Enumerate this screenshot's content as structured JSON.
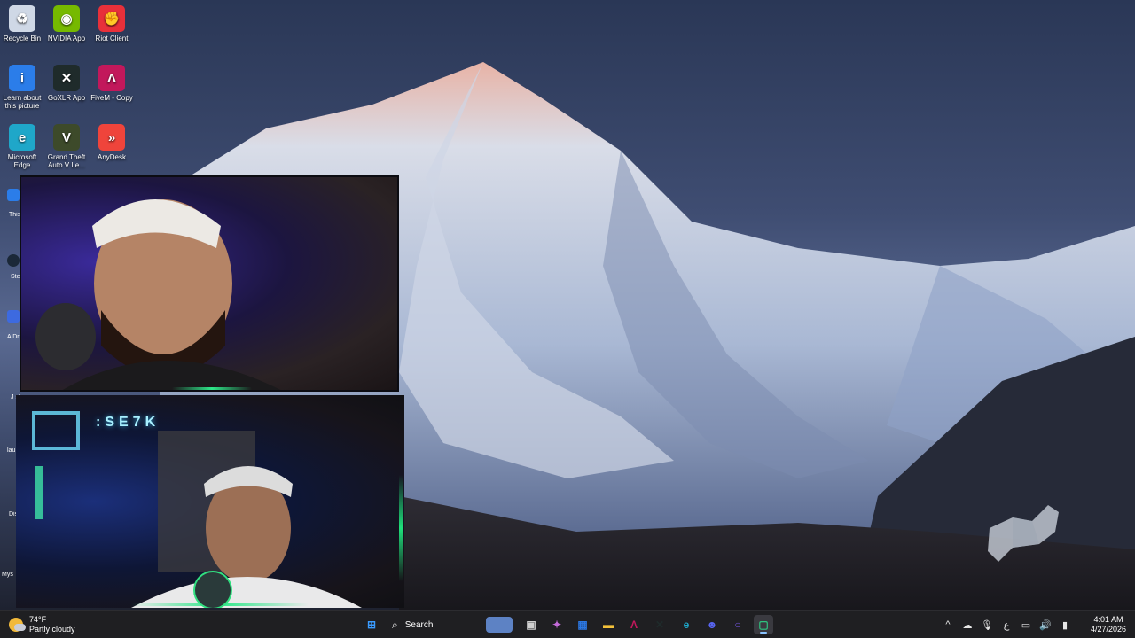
{
  "desktop": {
    "icons": [
      {
        "label": "Recycle Bin",
        "icon": "recycle-bin-icon",
        "color": "#cfd8e6"
      },
      {
        "label": "NVIDIA App",
        "icon": "nvidia-icon",
        "color": "#76b900"
      },
      {
        "label": "Riot Client",
        "icon": "riot-client-icon",
        "color": "#e8303a"
      },
      {
        "label": "Learn about this picture",
        "icon": "learn-picture-icon",
        "color": "#2b7de9"
      },
      {
        "label": "GoXLR App",
        "icon": "goxlr-icon",
        "color": "#1f2b2b"
      },
      {
        "label": "FiveM - Copy",
        "icon": "fivem-icon",
        "color": "#c2185b"
      },
      {
        "label": "Microsoft Edge",
        "icon": "edge-icon",
        "color": "#1fa7c9"
      },
      {
        "label": "Grand Theft Auto V Le...",
        "icon": "gta-v-icon",
        "color": "#3d4a2a"
      },
      {
        "label": "AnyDesk",
        "icon": "anydesk-icon",
        "color": "#ef443b"
      }
    ],
    "partial_icon_labels": [
      "This Sho",
      "Ste",
      "A Drive",
      "J sh",
      "lau Sh",
      "Dis",
      "Mys"
    ]
  },
  "overlay": {
    "brand_text": ":SE7K"
  },
  "taskbar": {
    "weather": {
      "temp": "74°F",
      "condition": "Partly cloudy"
    },
    "search_label": "Search",
    "apps": [
      {
        "name": "start-button",
        "icon": "windows-start-icon",
        "color": "#3a9bff"
      },
      {
        "name": "task-view",
        "icon": "task-view-icon",
        "color": "#d0d0d0"
      },
      {
        "name": "copilot",
        "icon": "copilot-icon",
        "color": "#c46bd9"
      },
      {
        "name": "microsoft-store",
        "icon": "store-icon",
        "color": "#2b78e4"
      },
      {
        "name": "file-explorer",
        "icon": "folder-icon",
        "color": "#f3c13a"
      },
      {
        "name": "fivem",
        "icon": "fivem-icon",
        "color": "#c2185b"
      },
      {
        "name": "goxlr",
        "icon": "goxlr-icon",
        "color": "#1f2b2b"
      },
      {
        "name": "edge",
        "icon": "edge-icon",
        "color": "#1fa7c9"
      },
      {
        "name": "discord",
        "icon": "discord-icon",
        "color": "#5865f2"
      },
      {
        "name": "cortana",
        "icon": "circle-app-icon",
        "color": "#7a5af0"
      },
      {
        "name": "obs-app",
        "icon": "app-icon",
        "color": "#2ec27e"
      }
    ],
    "tray": {
      "chevron": "^",
      "lang": "ع",
      "time": "4:01 AM",
      "date": "4/27/2026"
    }
  }
}
